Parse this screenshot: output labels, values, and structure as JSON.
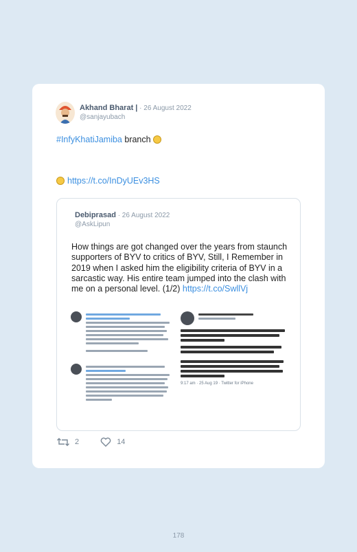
{
  "tweet": {
    "author_name": "Akhand Bharat |",
    "date": " · 26 August 2022",
    "handle": "@sanjayubach",
    "hashtag": "#InfyKhatiJamiba",
    "text_after_hashtag": " branch ",
    "link": "https://t.co/InDyUEv3HS",
    "retweets": "2",
    "likes": "14"
  },
  "quoted": {
    "author_name": "Debiprasad",
    "date": " · 26 August 2022",
    "handle": "@AskLipun",
    "text": "How things are got changed over the years from staunch supporters of BYV to critics of BYV, Still, I Remember in 2019 when I asked him the eligibility criteria of BYV in a sarcastic way. His entire team jumped into the clash with me on a personal level. (1/2) ",
    "link": "https://t.co/SwllVj",
    "embedded_right": {
      "footer": "9:17 am · 25 Aug 19 · Twitter for iPhone"
    }
  },
  "page_number": "178",
  "colors": {
    "background": "#dde9f3",
    "card": "#ffffff",
    "link": "#3b8fe0"
  },
  "icons": [
    "avatar-image",
    "smile-emoji",
    "laugh-emoji",
    "retweet-icon",
    "heart-icon"
  ]
}
